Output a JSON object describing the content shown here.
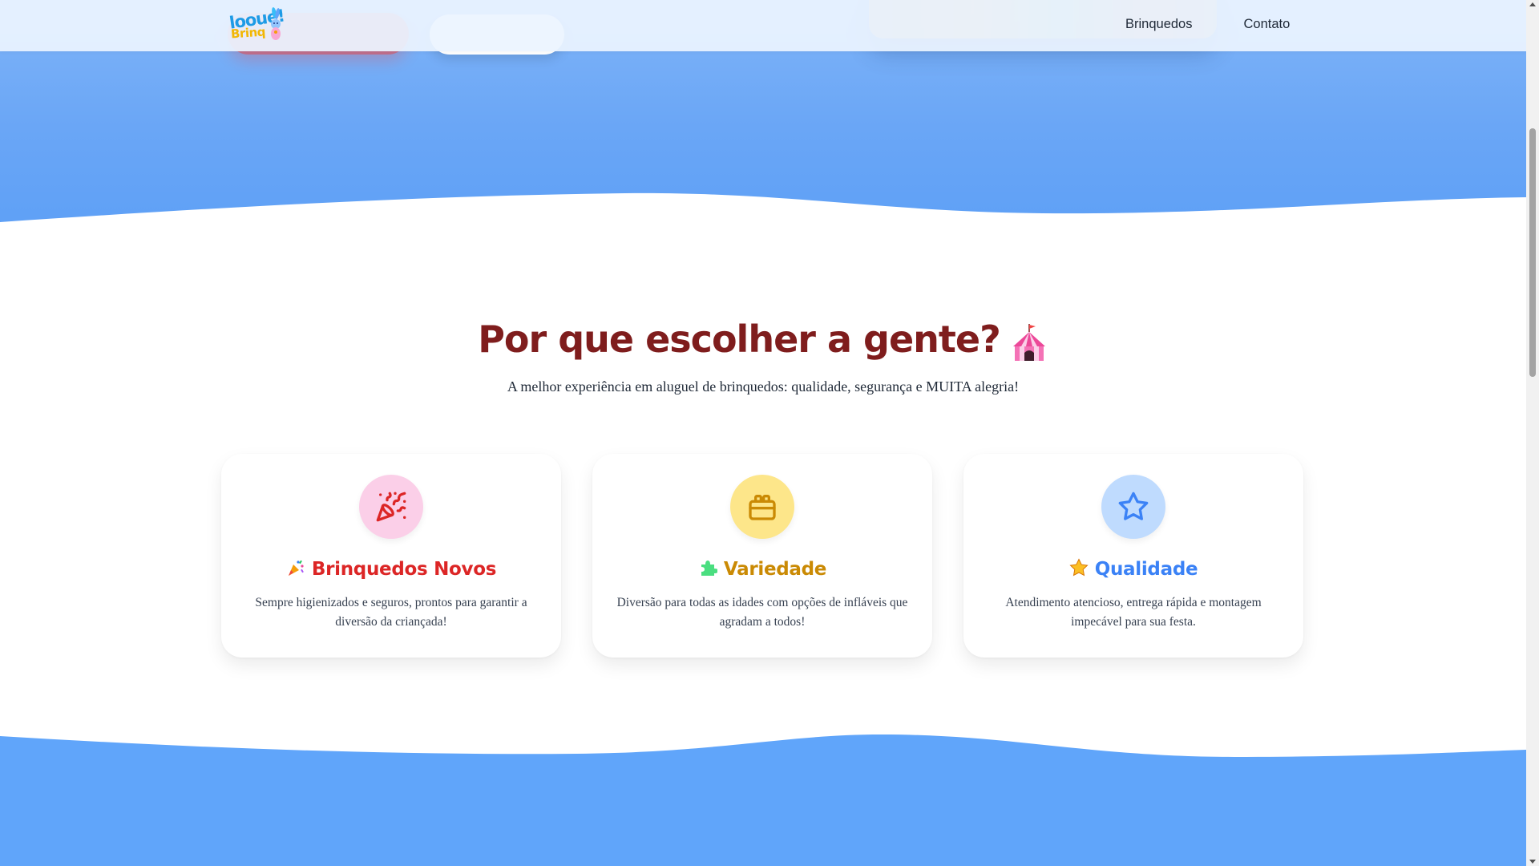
{
  "header": {
    "logo_line1": "looue!",
    "logo_line2": "Brinq",
    "nav": [
      {
        "label": "Brinquedos"
      },
      {
        "label": "Contato"
      }
    ]
  },
  "section": {
    "title": "Por que escolher a gente?",
    "title_icon": "circus-tent-icon",
    "subtitle": "A melhor experiência em aluguel de brinquedos: qualidade, segurança e MUITA alegria!"
  },
  "cards": [
    {
      "icon": "party-popper-icon",
      "emoji": "party-popper-emoji",
      "title": "Brinquedos Novos",
      "text": "Sempre higienizados e seguros, prontos para garantir a diversão da criançada!",
      "accent": "#dc2626",
      "bg": "#fbcfe8"
    },
    {
      "icon": "blocks-icon",
      "emoji": "puzzle-piece-emoji",
      "title": "Variedade",
      "text": "Diversão para todas as idades com opções de infláveis que agradam a todos!",
      "accent": "#ca8a04",
      "bg": "#fde68a"
    },
    {
      "icon": "star-icon",
      "emoji": "star-emoji",
      "title": "Qualidade",
      "text": "Atendimento atencioso, entrega rápida e montagem impecável para sua festa.",
      "accent": "#3b82f6",
      "bg": "#bfdbfe"
    }
  ],
  "colors": {
    "hero_blue": "#60a5fa",
    "title_red": "#7f1d1d",
    "cta_red": "#ef4444"
  }
}
